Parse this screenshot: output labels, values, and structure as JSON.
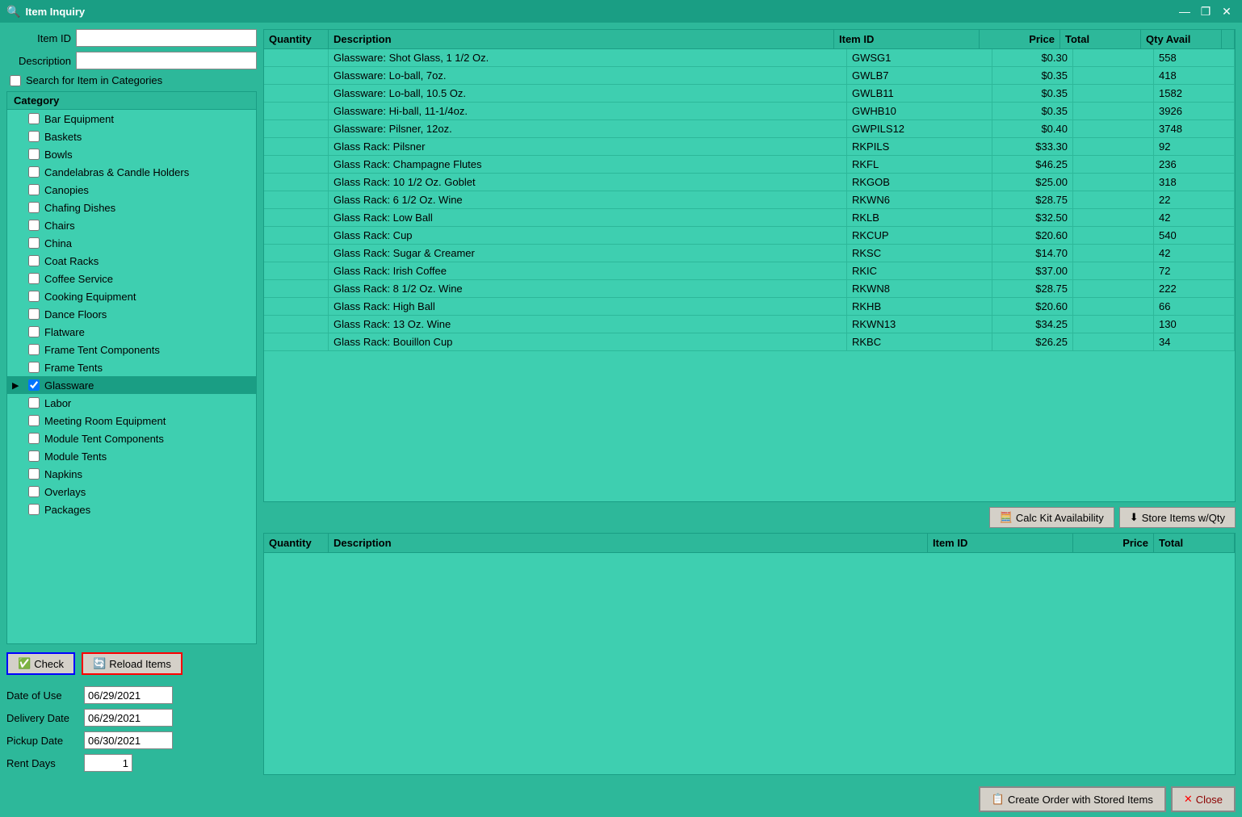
{
  "window": {
    "title": "Item Inquiry",
    "icon": "🔍"
  },
  "titlebar": {
    "minimize": "—",
    "restore": "❐",
    "close": "✕"
  },
  "left": {
    "item_id_label": "Item ID",
    "description_label": "Description",
    "search_checkbox_label": "Search for Item in Categories",
    "category_header": "Category",
    "categories": [
      {
        "name": "Bar Equipment",
        "checked": false,
        "arrow": ""
      },
      {
        "name": "Baskets",
        "checked": false,
        "arrow": ""
      },
      {
        "name": "Bowls",
        "checked": false,
        "arrow": ""
      },
      {
        "name": "Candelabras & Candle Holders",
        "checked": false,
        "arrow": ""
      },
      {
        "name": "Canopies",
        "checked": false,
        "arrow": ""
      },
      {
        "name": "Chafing Dishes",
        "checked": false,
        "arrow": ""
      },
      {
        "name": "Chairs",
        "checked": false,
        "arrow": ""
      },
      {
        "name": "China",
        "checked": false,
        "arrow": ""
      },
      {
        "name": "Coat Racks",
        "checked": false,
        "arrow": ""
      },
      {
        "name": "Coffee Service",
        "checked": false,
        "arrow": ""
      },
      {
        "name": "Cooking Equipment",
        "checked": false,
        "arrow": ""
      },
      {
        "name": "Dance Floors",
        "checked": false,
        "arrow": ""
      },
      {
        "name": "Flatware",
        "checked": false,
        "arrow": ""
      },
      {
        "name": "Frame Tent Components",
        "checked": false,
        "arrow": ""
      },
      {
        "name": "Frame Tents",
        "checked": false,
        "arrow": ""
      },
      {
        "name": "Glassware",
        "checked": true,
        "arrow": "▶",
        "active": true
      },
      {
        "name": "Labor",
        "checked": false,
        "arrow": ""
      },
      {
        "name": "Meeting Room Equipment",
        "checked": false,
        "arrow": ""
      },
      {
        "name": "Module Tent Components",
        "checked": false,
        "arrow": ""
      },
      {
        "name": "Module Tents",
        "checked": false,
        "arrow": ""
      },
      {
        "name": "Napkins",
        "checked": false,
        "arrow": ""
      },
      {
        "name": "Overlays",
        "checked": false,
        "arrow": ""
      },
      {
        "name": "Packages",
        "checked": false,
        "arrow": ""
      }
    ],
    "check_btn": "Check",
    "reload_btn": "Reload Items",
    "date_of_use_label": "Date of Use",
    "date_of_use_value": "06/29/2021",
    "delivery_date_label": "Delivery Date",
    "delivery_date_value": "06/29/2021",
    "pickup_date_label": "Pickup Date",
    "pickup_date_value": "06/30/2021",
    "rent_days_label": "Rent Days",
    "rent_days_value": "1"
  },
  "top_table": {
    "columns": {
      "quantity": "Quantity",
      "description": "Description",
      "item_id": "Item ID",
      "price": "Price",
      "total": "Total",
      "qty_avail": "Qty Avail"
    },
    "rows": [
      {
        "qty": "",
        "desc": "Glassware: Shot Glass, 1 1/2 Oz.",
        "item_id": "GWSG1",
        "price": "$0.30",
        "total": "",
        "qty_avail": "558"
      },
      {
        "qty": "",
        "desc": "Glassware: Lo-ball, 7oz.",
        "item_id": "GWLB7",
        "price": "$0.35",
        "total": "",
        "qty_avail": "418"
      },
      {
        "qty": "",
        "desc": "Glassware: Lo-ball, 10.5 Oz.",
        "item_id": "GWLB11",
        "price": "$0.35",
        "total": "",
        "qty_avail": "1582"
      },
      {
        "qty": "",
        "desc": "Glassware: Hi-ball, 11-1/4oz.",
        "item_id": "GWHB10",
        "price": "$0.35",
        "total": "",
        "qty_avail": "3926"
      },
      {
        "qty": "",
        "desc": "Glassware: Pilsner, 12oz.",
        "item_id": "GWPILS12",
        "price": "$0.40",
        "total": "",
        "qty_avail": "3748"
      },
      {
        "qty": "",
        "desc": "Glass Rack: Pilsner",
        "item_id": "RKPILS",
        "price": "$33.30",
        "total": "",
        "qty_avail": "92"
      },
      {
        "qty": "",
        "desc": "Glass Rack: Champagne Flutes",
        "item_id": "RKFL",
        "price": "$46.25",
        "total": "",
        "qty_avail": "236"
      },
      {
        "qty": "",
        "desc": "Glass Rack: 10 1/2 Oz. Goblet",
        "item_id": "RKGOB",
        "price": "$25.00",
        "total": "",
        "qty_avail": "318"
      },
      {
        "qty": "",
        "desc": "Glass Rack: 6 1/2 Oz. Wine",
        "item_id": "RKWN6",
        "price": "$28.75",
        "total": "",
        "qty_avail": "22"
      },
      {
        "qty": "",
        "desc": "Glass Rack: Low Ball",
        "item_id": "RKLB",
        "price": "$32.50",
        "total": "",
        "qty_avail": "42"
      },
      {
        "qty": "",
        "desc": "Glass Rack: Cup",
        "item_id": "RKCUP",
        "price": "$20.60",
        "total": "",
        "qty_avail": "540"
      },
      {
        "qty": "",
        "desc": "Glass Rack: Sugar & Creamer",
        "item_id": "RKSC",
        "price": "$14.70",
        "total": "",
        "qty_avail": "42"
      },
      {
        "qty": "",
        "desc": "Glass Rack: Irish Coffee",
        "item_id": "RKIC",
        "price": "$37.00",
        "total": "",
        "qty_avail": "72"
      },
      {
        "qty": "",
        "desc": "Glass Rack: 8 1/2 Oz. Wine",
        "item_id": "RKWN8",
        "price": "$28.75",
        "total": "",
        "qty_avail": "222"
      },
      {
        "qty": "",
        "desc": "Glass Rack: High Ball",
        "item_id": "RKHB",
        "price": "$20.60",
        "total": "",
        "qty_avail": "66"
      },
      {
        "qty": "",
        "desc": "Glass Rack: 13 Oz. Wine",
        "item_id": "RKWN13",
        "price": "$34.25",
        "total": "",
        "qty_avail": "130"
      },
      {
        "qty": "",
        "desc": "Glass Rack: Bouillon Cup",
        "item_id": "RKBC",
        "price": "$26.25",
        "total": "",
        "qty_avail": "34"
      }
    ]
  },
  "middle_buttons": {
    "calc_kit": "Calc Kit Availability",
    "store_items": "Store Items w/Qty"
  },
  "bottom_table": {
    "columns": {
      "quantity": "Quantity",
      "description": "Description",
      "item_id": "Item ID",
      "price": "Price",
      "total": "Total"
    },
    "rows": []
  },
  "action_bar": {
    "create_order": "Create Order with Stored Items",
    "close": "Close"
  }
}
